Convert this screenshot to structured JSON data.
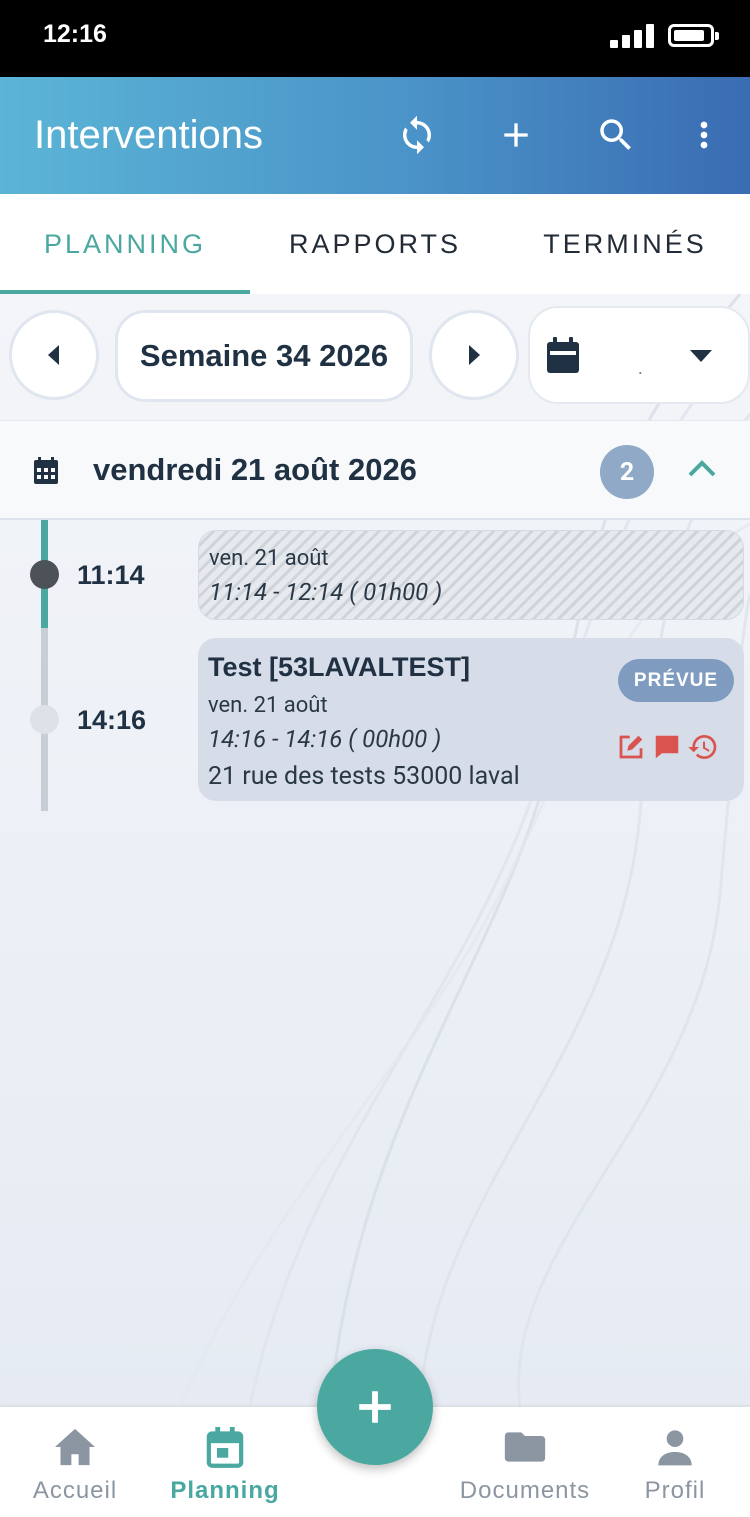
{
  "status_bar": {
    "time": "12:16"
  },
  "app_bar": {
    "title": "Interventions",
    "actions": [
      "sync-icon",
      "add-icon",
      "search-icon",
      "more-vert-icon"
    ]
  },
  "tabs": [
    {
      "label": "PLANNING",
      "active": true
    },
    {
      "label": "RAPPORTS",
      "active": false
    },
    {
      "label": "TERMINÉS",
      "active": false
    }
  ],
  "week_nav": {
    "label": "Semaine 34 2026",
    "calendar_value": "."
  },
  "day": {
    "label": "vendredi 21 août 2026",
    "count": "2"
  },
  "interventions": [
    {
      "time": "11:14",
      "date": "ven. 21 août",
      "range": "11:14 - 12:14 ( 01h00 )"
    },
    {
      "time": "14:16",
      "title": "Test [53LAVALTEST]",
      "date": "ven. 21 août",
      "range": "14:16 - 14:16 ( 00h00 )",
      "address": "21 rue des tests 53000 laval",
      "status": "PRÉVUE"
    }
  ],
  "bottom_nav": [
    {
      "label": "Accueil",
      "icon": "home-icon"
    },
    {
      "label": "Planning",
      "icon": "calendar-icon",
      "active": true
    },
    {
      "label": "Documents",
      "icon": "folder-icon"
    },
    {
      "label": "Profil",
      "icon": "person-icon"
    }
  ],
  "colors": {
    "accent": "#4aa8a0",
    "header_start": "#5bb5d6",
    "header_end": "#3a6cb2",
    "action_red": "#d9534f",
    "status_badge": "#7f9cc0"
  }
}
